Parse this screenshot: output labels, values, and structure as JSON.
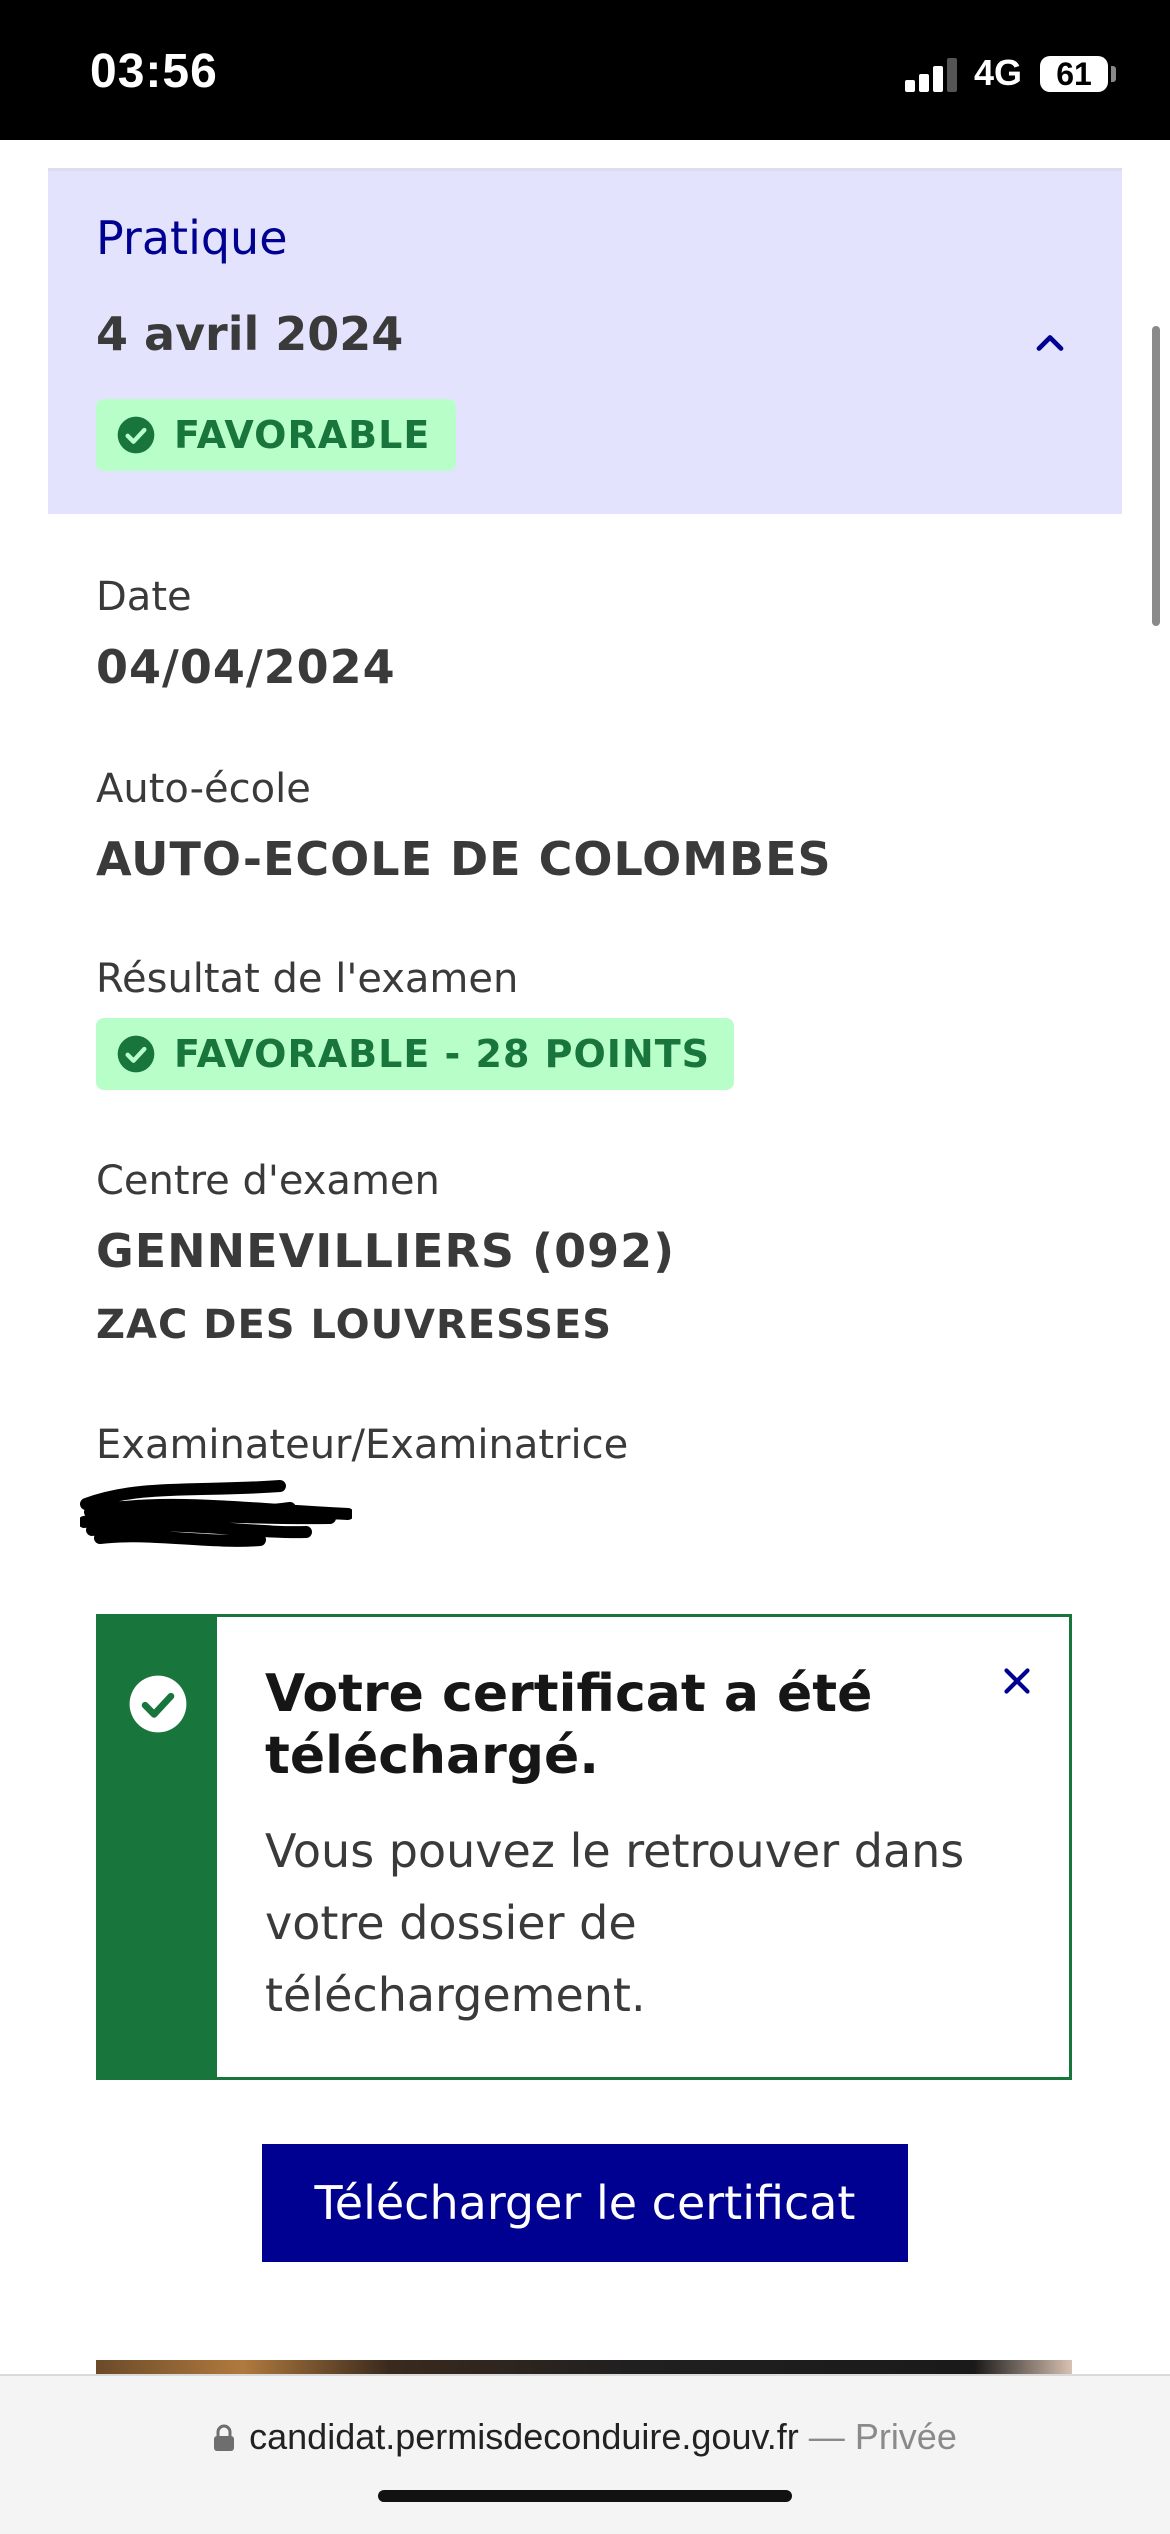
{
  "status_bar": {
    "time": "03:56",
    "network": "4G",
    "battery": "61"
  },
  "accordion": {
    "section": "Pratique",
    "date": "4 avril 2024",
    "badge": "FAVORABLE",
    "expanded": true
  },
  "fields": {
    "date_label": "Date",
    "date_value": "04/04/2024",
    "school_label": "Auto-école",
    "school_value": "AUTO-ECOLE DE COLOMBES",
    "result_label": "Résultat de l'examen",
    "result_value": "FAVORABLE - 28 POINTS",
    "center_label": "Centre d'examen",
    "center_value": "GENNEVILLIERS (092)",
    "center_sub": "ZAC DES LOUVRESSES",
    "examiner_label": "Examinateur/Examinatrice"
  },
  "alert": {
    "title": "Votre certificat a été téléchargé.",
    "text": "Vous pouvez le retrouver dans votre dossier de téléchargement."
  },
  "download_button": "Télécharger le certificat",
  "browser": {
    "url": "candidat.permisdeconduire.gouv.fr",
    "separator": " — ",
    "mode": "Privée"
  },
  "colors": {
    "primary": "#000091",
    "accordion_bg": "#e3e3fd",
    "success": "#18753c",
    "success_bg": "#b8fec9"
  }
}
